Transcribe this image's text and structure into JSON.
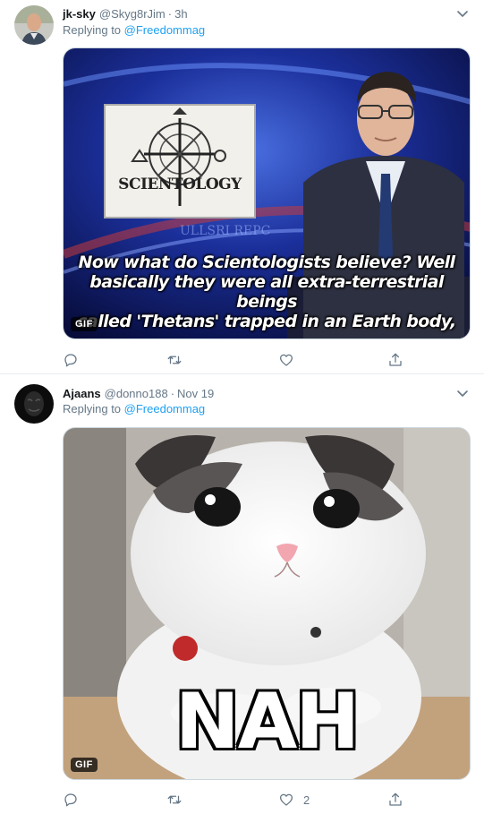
{
  "colors": {
    "link": "#1da1f2",
    "muted": "#657786",
    "text": "#14171a",
    "border": "#e6ecf0"
  },
  "tweets": [
    {
      "name": "jk-sky",
      "handle": "@Skyg8rJim",
      "separator": "·",
      "time": "3h",
      "replying_prefix": "Replying to ",
      "replying_to": "@Freedommag",
      "media": {
        "type": "gif",
        "badge": "GIF",
        "sign_text": "SCIENTOLOGY",
        "caption_line1": "Now what do Scientologists believe? Well",
        "caption_line2": "basically they were all extra-terrestrial beings",
        "caption_line3": "called 'Thetans' trapped in an Earth body,"
      },
      "actions": {
        "reply_icon": "reply-icon",
        "retweet_icon": "retweet-icon",
        "like_icon": "heart-icon",
        "share_icon": "share-icon",
        "like_count": ""
      }
    },
    {
      "name": "Ajaans",
      "handle": "@donno188",
      "separator": "·",
      "time": "Nov 19",
      "replying_prefix": "Replying to ",
      "replying_to": "@Freedommag",
      "media": {
        "type": "gif",
        "badge": "GIF",
        "overlay_text": "NAH"
      },
      "actions": {
        "reply_icon": "reply-icon",
        "retweet_icon": "retweet-icon",
        "like_icon": "heart-icon",
        "share_icon": "share-icon",
        "like_count": "2"
      }
    }
  ]
}
